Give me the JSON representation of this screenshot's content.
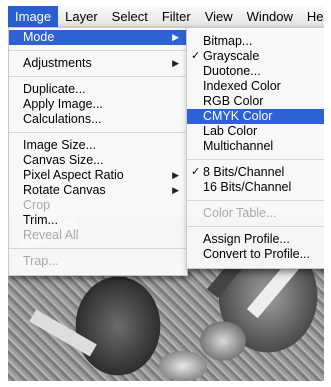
{
  "menubar": {
    "items": [
      "Image",
      "Layer",
      "Select",
      "Filter",
      "View",
      "Window",
      "He"
    ]
  },
  "image_menu": {
    "mode": "Mode",
    "adjustments": "Adjustments",
    "duplicate": "Duplicate...",
    "apply_image": "Apply Image...",
    "calculations": "Calculations...",
    "image_size": "Image Size...",
    "canvas_size": "Canvas Size...",
    "pixel_aspect_ratio": "Pixel Aspect Ratio",
    "rotate_canvas": "Rotate Canvas",
    "crop": "Crop",
    "trim": "Trim...",
    "reveal_all": "Reveal All",
    "trap": "Trap..."
  },
  "mode_submenu": {
    "bitmap": "Bitmap...",
    "grayscale": "Grayscale",
    "duotone": "Duotone...",
    "indexed_color": "Indexed Color",
    "rgb_color": "RGB Color",
    "cmyk_color": "CMYK Color",
    "lab_color": "Lab Color",
    "multichannel": "Multichannel",
    "bits8": "8 Bits/Channel",
    "bits16": "16 Bits/Channel",
    "color_table": "Color Table...",
    "assign_profile": "Assign Profile...",
    "convert_to_profile": "Convert to Profile..."
  },
  "icons": {
    "submenu_arrow": "▶",
    "checkmark": "✓"
  },
  "colors": {
    "highlight": "#2c62d3",
    "disabled_text": "#a8a8a8"
  }
}
